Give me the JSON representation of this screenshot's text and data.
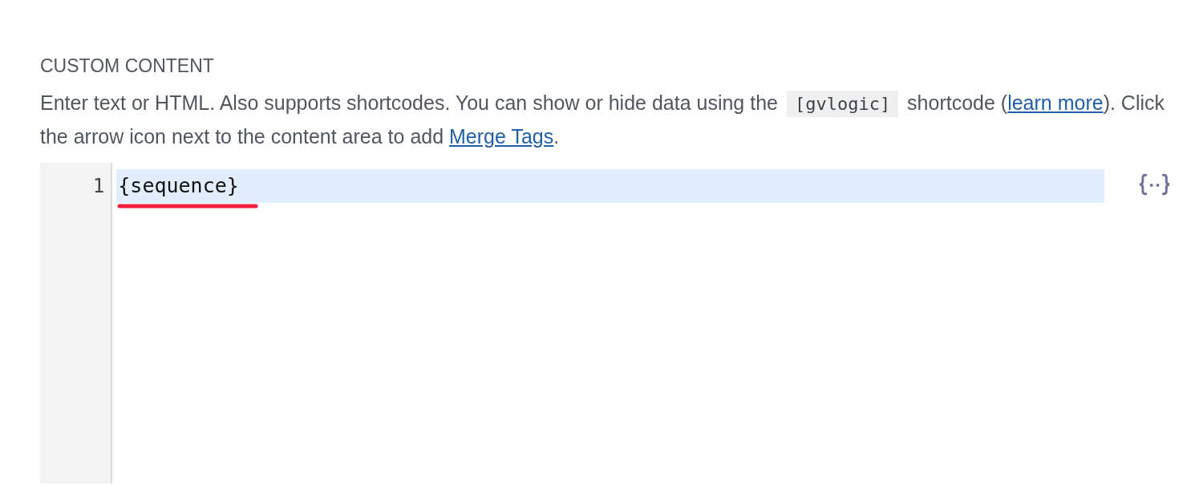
{
  "section_title": "CUSTOM CONTENT",
  "description": [
    {
      "kind": "text",
      "text": "Enter text or HTML. Also supports shortcodes. You can show or hide data using the "
    },
    {
      "kind": "code",
      "text": "[gvlogic]"
    },
    {
      "kind": "text",
      "text": " shortcode ("
    },
    {
      "kind": "link",
      "text": "learn more"
    },
    {
      "kind": "text",
      "text": "). Click the arrow icon next to the content area to add "
    },
    {
      "kind": "link",
      "text": "Merge Tags"
    },
    {
      "kind": "text",
      "text": "."
    }
  ],
  "editor": {
    "lines": [
      {
        "number": "1",
        "text": "{sequence}",
        "selected": true
      }
    ]
  }
}
